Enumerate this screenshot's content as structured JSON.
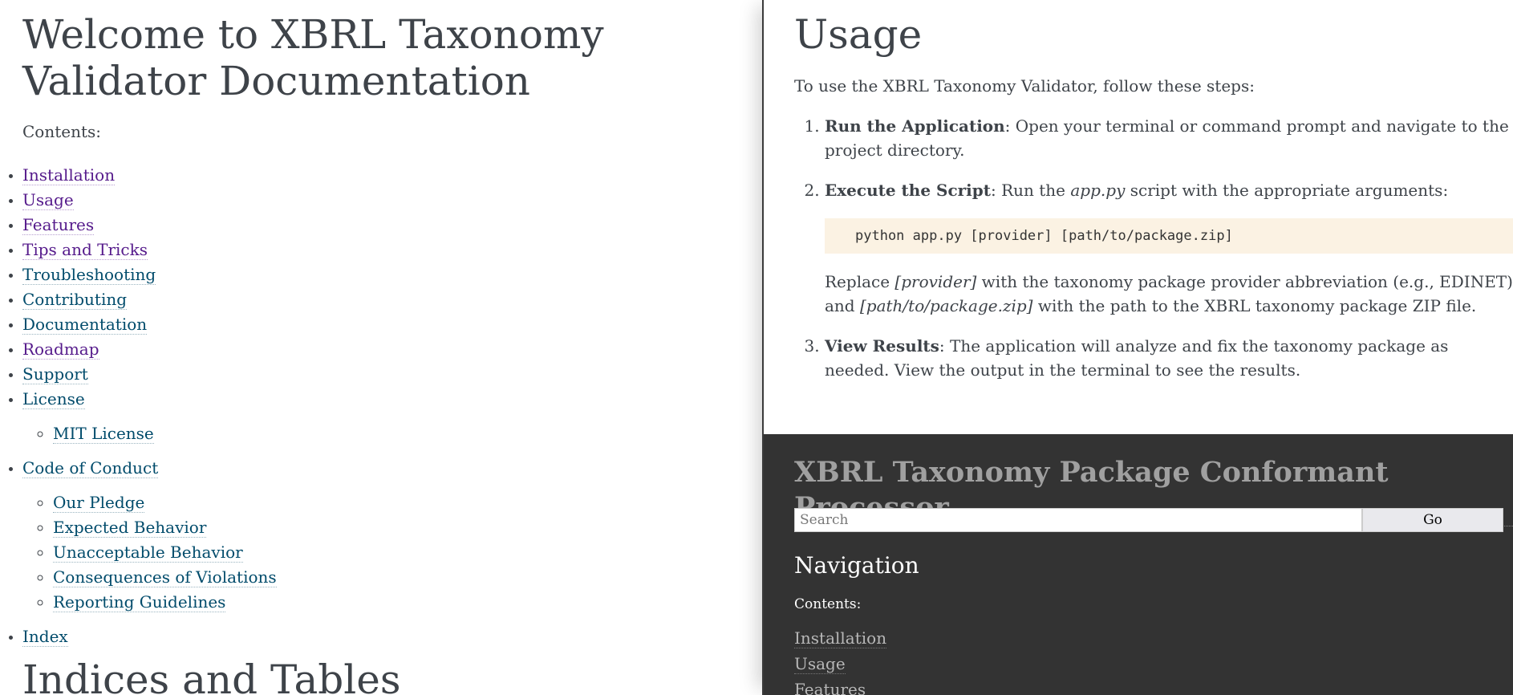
{
  "left": {
    "title": "Welcome to XBRL Taxonomy Validator Documentation",
    "contents_caption": "Contents:",
    "toc": [
      {
        "label": "Installation",
        "visited": true
      },
      {
        "label": "Usage",
        "visited": true
      },
      {
        "label": "Features",
        "visited": true
      },
      {
        "label": "Tips and Tricks",
        "visited": true
      },
      {
        "label": "Troubleshooting",
        "visited": false
      },
      {
        "label": "Contributing",
        "visited": false
      },
      {
        "label": "Documentation",
        "visited": false
      },
      {
        "label": "Roadmap",
        "visited": true
      },
      {
        "label": "Support",
        "visited": false
      },
      {
        "label": "License",
        "visited": false,
        "children": [
          "MIT License"
        ]
      },
      {
        "label": "Code of Conduct",
        "visited": false,
        "children": [
          "Our Pledge",
          "Expected Behavior",
          "Unacceptable Behavior",
          "Consequences of Violations",
          "Reporting Guidelines"
        ]
      },
      {
        "label": "Index",
        "visited": false
      }
    ],
    "indices_title": "Indices and Tables"
  },
  "right": {
    "usage_title": "Usage",
    "intro": "To use the XBRL Taxonomy Validator, follow these steps:",
    "step1": {
      "bold": "Run the Application",
      "text": ": Open your terminal or command prompt and navigate to the project directory."
    },
    "step2": {
      "bold": "Execute the Script",
      "pre": ": Run the ",
      "italic": "app.py",
      "post": " script with the appropriate arguments:"
    },
    "code": "python app.py [provider] [path/to/package.zip]",
    "replace": {
      "pre": "Replace ",
      "provider": "[provider]",
      "mid": " with the taxonomy package provider abbreviation (e.g., EDINET) and ",
      "path": "[path/to/package.zip]",
      "post": " with the path to the XBRL taxonomy package ZIP file."
    },
    "step3": {
      "bold": "View Results",
      "text": ": The application will analyze and fix the taxonomy package as needed. View the output in the terminal to see the results."
    }
  },
  "sidebar": {
    "title": "XBRL Taxonomy Package Conformant Processor",
    "search_placeholder": "Search",
    "go_label": "Go",
    "nav_heading": "Navigation",
    "contents_caption": "Contents:",
    "items": [
      "Installation",
      "Usage",
      "Features"
    ]
  },
  "colors": {
    "text": "#3e4349",
    "link": "#004b6b",
    "visited_link": "#551a8b",
    "code_bg": "#fbf2e3",
    "sidebar_bg": "#333333"
  }
}
